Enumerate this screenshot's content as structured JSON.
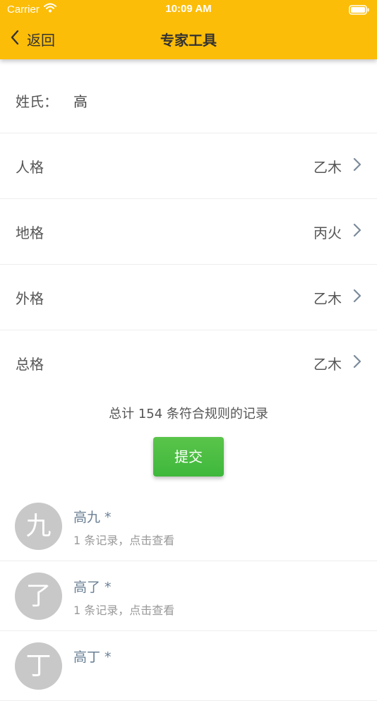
{
  "status_bar": {
    "carrier": "Carrier",
    "time": "10:09 AM"
  },
  "nav": {
    "back_label": "返回",
    "title": "专家工具"
  },
  "surname_row": {
    "label": "姓氏：",
    "value": "高"
  },
  "rows": [
    {
      "label": "人格",
      "value": "乙木"
    },
    {
      "label": "地格",
      "value": "丙火"
    },
    {
      "label": "外格",
      "value": "乙木"
    },
    {
      "label": "总格",
      "value": "乙木"
    }
  ],
  "summary": "总计 154 条符合规则的记录",
  "submit_label": "提交",
  "results": [
    {
      "avatar": "九",
      "name": "高九 *",
      "sub": "1 条记录，点击查看"
    },
    {
      "avatar": "了",
      "name": "高了 *",
      "sub": "1 条记录，点击查看"
    },
    {
      "avatar": "丁",
      "name": "高丁 *",
      "sub": ""
    }
  ],
  "colors": {
    "accent": "#fcbd08",
    "submit_green": "#48bb40",
    "avatar_gray": "#c8c8c8",
    "link_name": "#6a7f94"
  },
  "icons": {
    "wifi": "wifi-icon",
    "battery": "battery-icon",
    "back": "chevron-left-icon",
    "row_arrow": "chevron-right-icon"
  }
}
